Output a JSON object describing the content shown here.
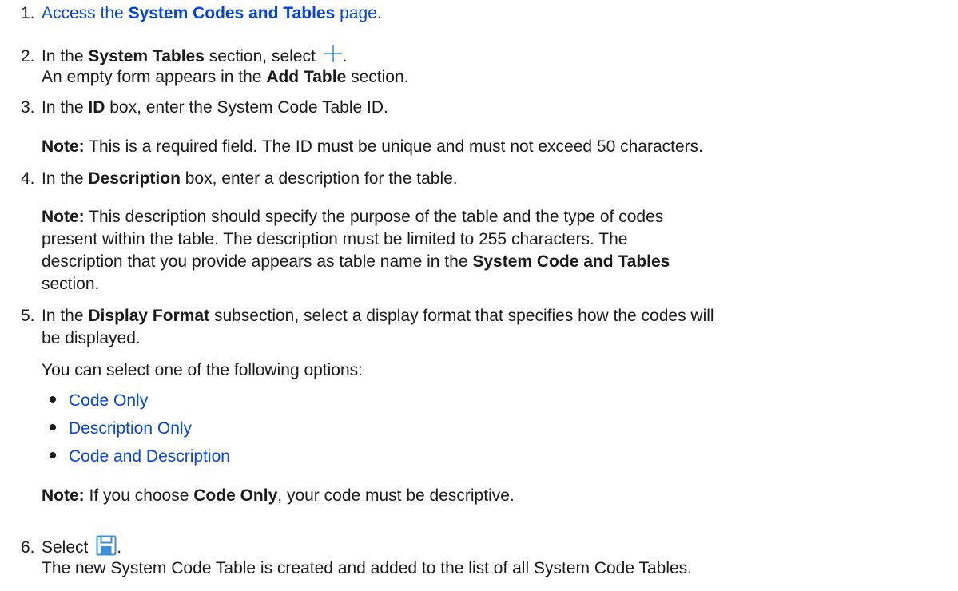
{
  "steps": [
    {
      "num": "1.",
      "parts": [
        "Access the ",
        "System Codes and Tables",
        " page",
        "."
      ]
    },
    {
      "num": "2.",
      "line1": [
        "In the ",
        "System Tables",
        " section, select ",
        "."
      ],
      "line2": [
        "An empty form appears in the ",
        "Add Table",
        " section."
      ]
    },
    {
      "num": "3.",
      "line1": [
        "In the ",
        "ID",
        " box, enter the System Code Table ID."
      ],
      "note_label": "Note:",
      "note_text": " This is a required field. The ID must be unique and must not exceed 50 characters."
    },
    {
      "num": "4.",
      "line1": [
        "In the ",
        "Description",
        " box, enter a description for the table."
      ],
      "note_label": "Note:",
      "note_line1": " This description should specify the purpose of the table and the type of codes",
      "note_line2": "present within the table. The description must be limited to 255 characters. The",
      "note_line3a": "description that you provide appears as table name in the ",
      "note_line3b": "System Code and Tables",
      "note_line4": "section."
    },
    {
      "num": "5.",
      "line1": [
        "In the ",
        "Display Format",
        " subsection, select a display format that specifies how the codes will"
      ],
      "line2": "be displayed.",
      "intro": "You can select one of the following options:",
      "options": [
        "Code Only",
        "Description Only",
        "Code and Description"
      ],
      "note_label": "Note:",
      "note_a": " If you choose ",
      "note_b": "Code Only",
      "note_c": ", your code must be descriptive."
    },
    {
      "num": "6.",
      "line1": [
        "Select ",
        "."
      ],
      "line2": "The new System Code Table is created and added to the list of all System Code Tables."
    }
  ],
  "icons": {
    "add": "plus-icon",
    "save": "save-icon"
  },
  "colors": {
    "link": "#0645d8",
    "text": "#1a1a1a",
    "icon_blue": "#3d8fd9"
  }
}
